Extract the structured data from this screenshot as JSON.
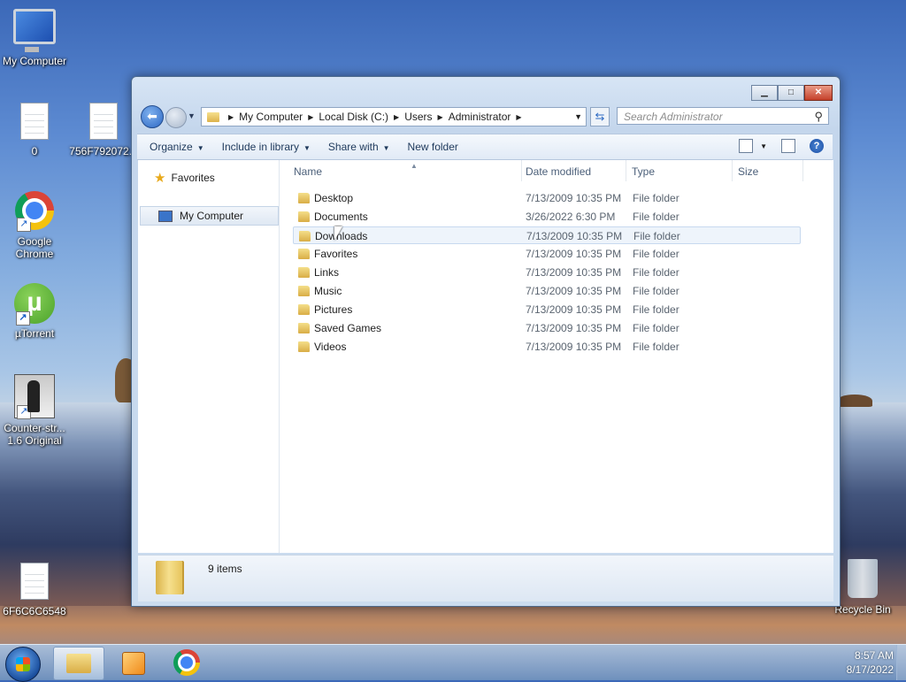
{
  "desktop": {
    "icons": [
      {
        "label": "My Computer"
      },
      {
        "label": "0"
      },
      {
        "label": "756F792072..."
      },
      {
        "label": "Google Chrome"
      },
      {
        "label": "µTorrent"
      },
      {
        "label": "Counter-str... 1.6 Original"
      },
      {
        "label": "6F6C6C6548"
      },
      {
        "label": "Recycle Bin"
      }
    ]
  },
  "window": {
    "controls": {
      "minimize": "▁",
      "maximize": "□",
      "close": "✕"
    },
    "address": {
      "crumbs": [
        "My Computer",
        "Local Disk (C:)",
        "Users",
        "Administrator"
      ]
    },
    "search": {
      "placeholder": "Search Administrator"
    },
    "toolbar": {
      "organize": "Organize",
      "include": "Include in library",
      "share": "Share with",
      "new_folder": "New folder"
    },
    "nav": {
      "favorites": "Favorites",
      "my_computer": "My Computer"
    },
    "columns": {
      "name": "Name",
      "date": "Date modified",
      "type": "Type",
      "size": "Size"
    },
    "files": [
      {
        "name": "Desktop",
        "date": "7/13/2009 10:35 PM",
        "type": "File folder"
      },
      {
        "name": "Documents",
        "date": "3/26/2022 6:30 PM",
        "type": "File folder"
      },
      {
        "name": "Downloads",
        "date": "7/13/2009 10:35 PM",
        "type": "File folder"
      },
      {
        "name": "Favorites",
        "date": "7/13/2009 10:35 PM",
        "type": "File folder"
      },
      {
        "name": "Links",
        "date": "7/13/2009 10:35 PM",
        "type": "File folder"
      },
      {
        "name": "Music",
        "date": "7/13/2009 10:35 PM",
        "type": "File folder"
      },
      {
        "name": "Pictures",
        "date": "7/13/2009 10:35 PM",
        "type": "File folder"
      },
      {
        "name": "Saved Games",
        "date": "7/13/2009 10:35 PM",
        "type": "File folder"
      },
      {
        "name": "Videos",
        "date": "7/13/2009 10:35 PM",
        "type": "File folder"
      }
    ],
    "status": {
      "count": "9 items"
    }
  },
  "taskbar": {
    "time": "8:57 AM",
    "date": "8/17/2022"
  }
}
